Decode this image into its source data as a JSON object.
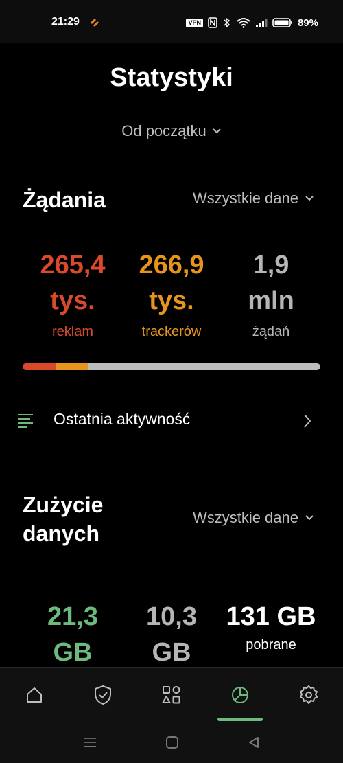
{
  "status_bar": {
    "time": "21:29",
    "vpn_label": "VPN",
    "battery": "89%"
  },
  "title": "Statystyki",
  "period_select": "Od początku",
  "requests": {
    "header": "Żądania",
    "filter": "Wszystkie dane",
    "stats": [
      {
        "value_line1": "265,4",
        "value_line2": "tys.",
        "label": "reklam",
        "color": "#d94a2b"
      },
      {
        "value_line1": "266,9",
        "value_line2": "tys.",
        "label": "trackerów",
        "color": "#e6951c"
      },
      {
        "value_line1": "1,9",
        "value_line2": "mln",
        "label": "żądań",
        "color": "#b5b5b5"
      }
    ],
    "progress": {
      "ads_fraction": 0.11,
      "trackers_fraction": 0.11
    }
  },
  "recent_activity": {
    "label": "Ostatnia aktywność"
  },
  "data_usage": {
    "header_line1": "Zużycie",
    "header_line2": "danych",
    "filter": "Wszystkie dane",
    "stats": [
      {
        "value_line1": "21,3",
        "value_line2": "GB",
        "color": "#6cba7d"
      },
      {
        "value_line1": "10,3",
        "value_line2": "GB",
        "color": "#b5b5b5"
      },
      {
        "value_line1": "131 GB",
        "label": "pobrane",
        "color": "#ffffff"
      }
    ]
  },
  "bottom_nav": {
    "items": [
      "home-icon",
      "shield-check-icon",
      "apps-grid-icon",
      "pie-chart-icon",
      "gear-icon"
    ],
    "active_index": 3,
    "accent": "#6cba7d"
  },
  "system_nav": {
    "items": [
      "menu-icon",
      "home-square-icon",
      "back-triangle-icon"
    ]
  }
}
